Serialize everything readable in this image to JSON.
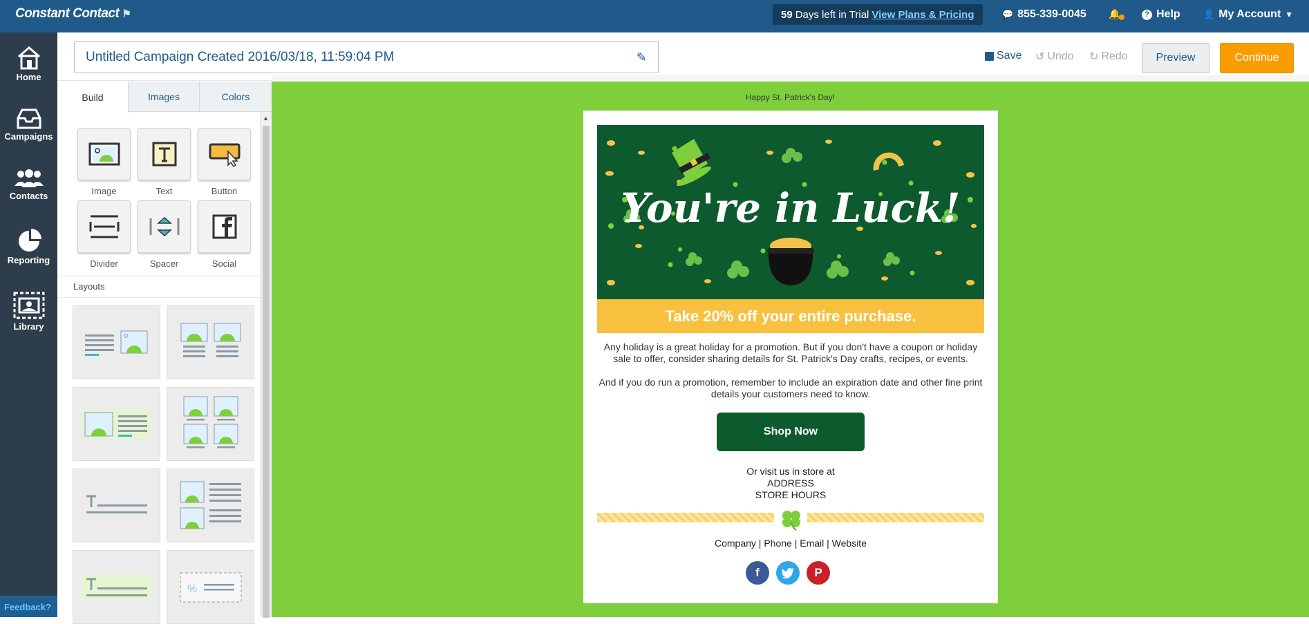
{
  "topbar": {
    "logo": "Constant Contact",
    "trial_days": "59",
    "trial_text": "Days left in Trial",
    "plans_link": "View Plans & Pricing",
    "phone": "855-339-0045",
    "help": "Help",
    "account": "My Account"
  },
  "nav": {
    "items": [
      {
        "label": "Home"
      },
      {
        "label": "Campaigns"
      },
      {
        "label": "Contacts"
      },
      {
        "label": "Reporting"
      },
      {
        "label": "Library"
      }
    ],
    "feedback": "Feedback?"
  },
  "header": {
    "campaign_title": "Untitled Campaign Created 2016/03/18, 11:59:04 PM",
    "save": "Save",
    "undo": "Undo",
    "redo": "Redo",
    "preview": "Preview",
    "continue": "Continue"
  },
  "panel": {
    "tabs": [
      "Build",
      "Images",
      "Colors"
    ],
    "tools": [
      "Image",
      "Text",
      "Button",
      "Divider",
      "Spacer",
      "Social"
    ],
    "layouts_heading": "Layouts"
  },
  "email": {
    "preheader": "Happy St. Patrick's Day!",
    "hero_text": "You're in Luck!",
    "promo": "Take 20% off your entire purchase.",
    "para1": "Any holiday is a great holiday for a promotion. But if you don't have a coupon or holiday sale to offer, consider sharing details for St. Patrick's Day crafts, recipes, or events.",
    "para2": "And if you do run a promotion, remember to include an expiration date and other fine print details your customers need to know.",
    "shop_button": "Shop Now",
    "store_line1": "Or visit us in store at",
    "store_line2": "ADDRESS",
    "store_line3": "STORE HOURS",
    "footer": "Company | Phone | Email | Website",
    "social": [
      "facebook-icon",
      "twitter-icon",
      "pinterest-icon"
    ]
  },
  "colors": {
    "topbar": "#1f5a8a",
    "nav": "#2e3d4c",
    "canvas": "#7fcf3c",
    "hero": "#0e5a2f",
    "promo": "#f7c13f",
    "continue": "#f79d00"
  }
}
